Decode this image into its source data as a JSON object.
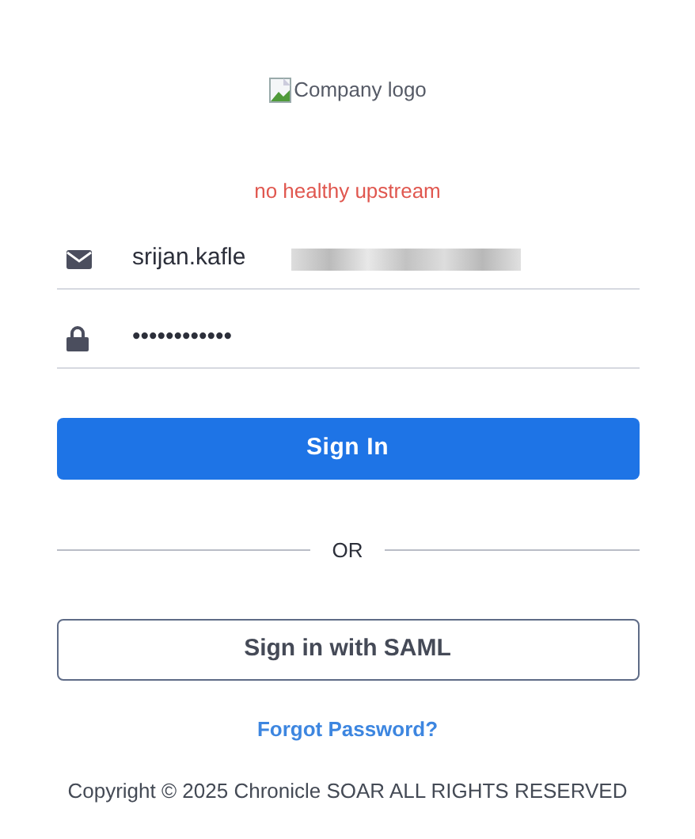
{
  "logo": {
    "alt": "Company logo"
  },
  "error": "no healthy upstream",
  "fields": [
    {
      "kind": "email",
      "value": "srijan.kafle",
      "redacted": true
    },
    {
      "kind": "password",
      "value": "••••••••••••",
      "redacted": false
    }
  ],
  "sign_in_button": "Sign In",
  "separator": "OR",
  "saml_button": "Sign in with SAML",
  "forgot_link": "Forgot Password?",
  "footer": "Copyright © 2025 Chronicle SOAR ALL RIGHTS RESERVED"
}
